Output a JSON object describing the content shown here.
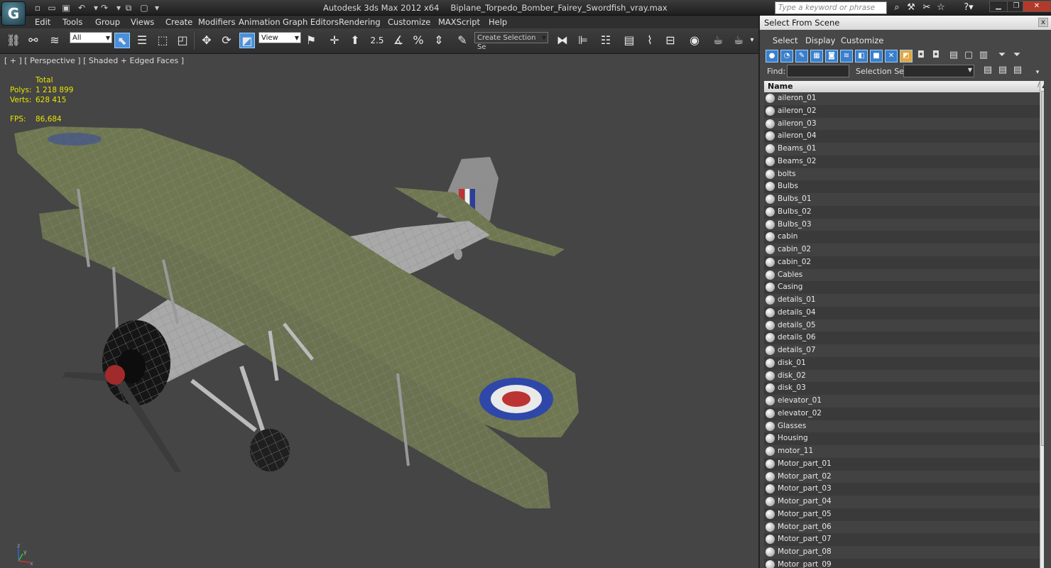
{
  "app": {
    "title": "Autodesk 3ds Max  2012 x64",
    "file": "Biplane_Torpedo_Bomber_Fairey_Swordfish_vray.max",
    "search_placeholder": "Type a keyword or phrase"
  },
  "menu": [
    "Edit",
    "Tools",
    "Group",
    "Views",
    "Create",
    "Modifiers",
    "Animation",
    "Graph Editors",
    "Rendering",
    "Customize",
    "MAXScript",
    "Help"
  ],
  "toolbar": {
    "filter_value": "All",
    "coord_value": "View",
    "snap_angle": "2.5",
    "selection_set_placeholder": "Create Selection Se"
  },
  "viewport": {
    "label": "[ + ] [ Perspective ] [ Shaded + Edged Faces ]",
    "stats_header": "Total",
    "polys_label": "Polys:",
    "polys_value": "1 218 899",
    "verts_label": "Verts:",
    "verts_value": "628 415",
    "fps_label": "FPS:",
    "fps_value": "86,684",
    "axis_x": "x",
    "axis_y": "y",
    "axis_z": "z"
  },
  "panel": {
    "title": "Select From Scene",
    "close_label": "x",
    "menu": [
      "Select",
      "Display",
      "Customize"
    ],
    "find_label": "Find:",
    "selection_set_label": "Selection Set:",
    "column_header": "Name",
    "sort_indicator": "/",
    "objects": [
      "aileron_01",
      "aileron_02",
      "aileron_03",
      "aileron_04",
      "Beams_01",
      "Beams_02",
      "bolts",
      "Bulbs",
      "Bulbs_01",
      "Bulbs_02",
      "Bulbs_03",
      "cabin",
      "cabin_02",
      "cabin_02",
      "Cables",
      "Casing",
      "details_01",
      "details_04",
      "details_05",
      "details_06",
      "details_07",
      "disk_01",
      "disk_02",
      "disk_03",
      "elevator_01",
      "elevator_02",
      "Glasses",
      "Housing",
      "motor_11",
      "Motor_part_01",
      "Motor_part_02",
      "Motor_part_03",
      "Motor_part_04",
      "Motor_part_05",
      "Motor_part_06",
      "Motor_part_07",
      "Motor_part_08",
      "Motor_part_09"
    ]
  },
  "colors": {
    "stats_text": "#e8e400",
    "viewport_bg": "#454545",
    "accent": "#4a8fd8"
  }
}
